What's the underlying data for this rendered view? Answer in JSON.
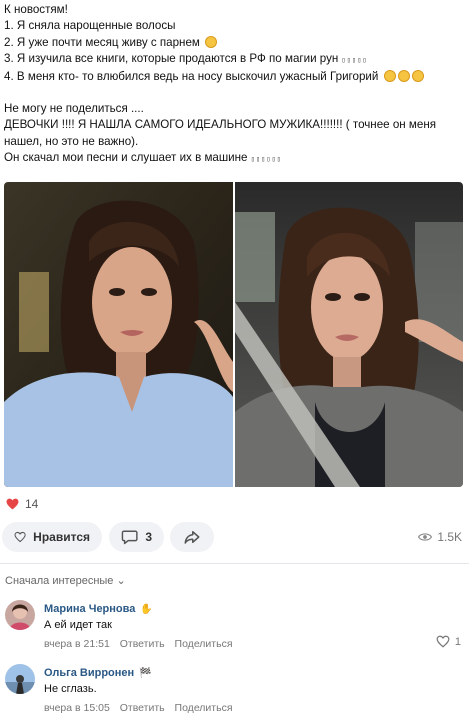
{
  "post": {
    "lines": [
      "К новостям!",
      "1. Я сняла нарощенные волосы",
      "2. Я уже почти месяц живу с парнем",
      "3. Я изучила все книги, которые продаются в РФ по магии рун",
      "4. В меня кто- то влюбился ведь на носу выскочил ужасный Григорий",
      "Не могу не поделиться ....",
      "ДЕВОЧКИ !!!! Я НАШЛА САМОГО ИДЕАЛЬНОГО МУЖИКА!!!!!!! ( точнее он меня",
      "нашел, но это не важно).",
      "Он скачал мои песни и слушает их в машине"
    ],
    "missing_glyphs": "▯▯▯▯▯",
    "missing_glyphs_long": "▯▯▯▯▯▯"
  },
  "reactions": {
    "likes_count": "14",
    "like_label": "Нравится",
    "comments_count": "3",
    "views": "1.5K"
  },
  "comments": {
    "sort_label": "Сначала интересные ⌄",
    "items": [
      {
        "author": "Марина Чернова",
        "text": "А ей идет так",
        "time": "вчера в 21:51",
        "reply": "Ответить",
        "share": "Поделиться",
        "likes": "1"
      },
      {
        "author": "Ольга Вирронен",
        "text": "Не сглазь.",
        "time": "вчера в 15:05",
        "reply": "Ответить",
        "share": "Поделиться"
      }
    ]
  },
  "colors": {
    "link": "#2a5885",
    "like_heart": "#e64646",
    "pill_bg": "#f0f2f5"
  }
}
